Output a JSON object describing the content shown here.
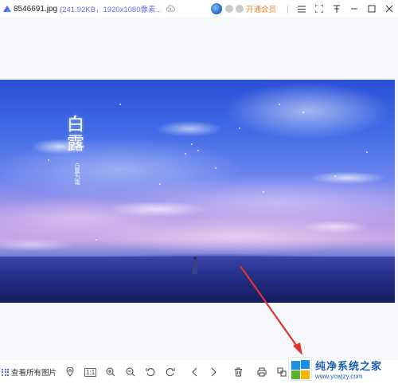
{
  "titlebar": {
    "filename": "8546691.jpg",
    "fileinfo": "(241.92KB，1920x1080像素...",
    "vip_link": "开通会员"
  },
  "image": {
    "calligraphy_title": "白露",
    "calligraphy_sub": "白露为霜"
  },
  "toolbar": {
    "view_all_label": "查看所有图片",
    "actual_size_label": "1:1"
  },
  "watermark": {
    "title": "纯净系统之家",
    "url": "www.ycwjzy.com"
  },
  "colors": {
    "accent": "#6b6fd6",
    "vip": "#e8892b",
    "arrow": "#e0332b"
  }
}
